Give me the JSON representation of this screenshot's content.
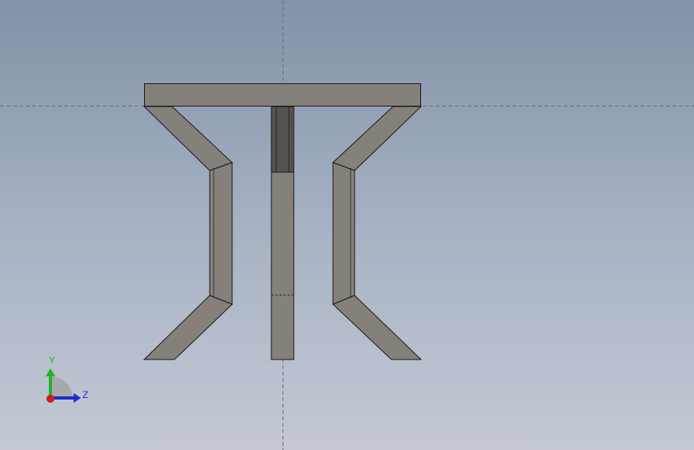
{
  "viewport": {
    "background_top": "#8392a7",
    "background_bottom": "#c4c9d4"
  },
  "model": {
    "face_color": "#858079",
    "edge_color": "#1a1a1a",
    "dark_face_color": "#56534f"
  },
  "triad": {
    "y_label": "Y",
    "z_label": "Z",
    "y_color": "#22b522",
    "z_color": "#1a2fd0",
    "x_color": "#cc1a1a",
    "icon": "view-orientation-triad-icon"
  }
}
